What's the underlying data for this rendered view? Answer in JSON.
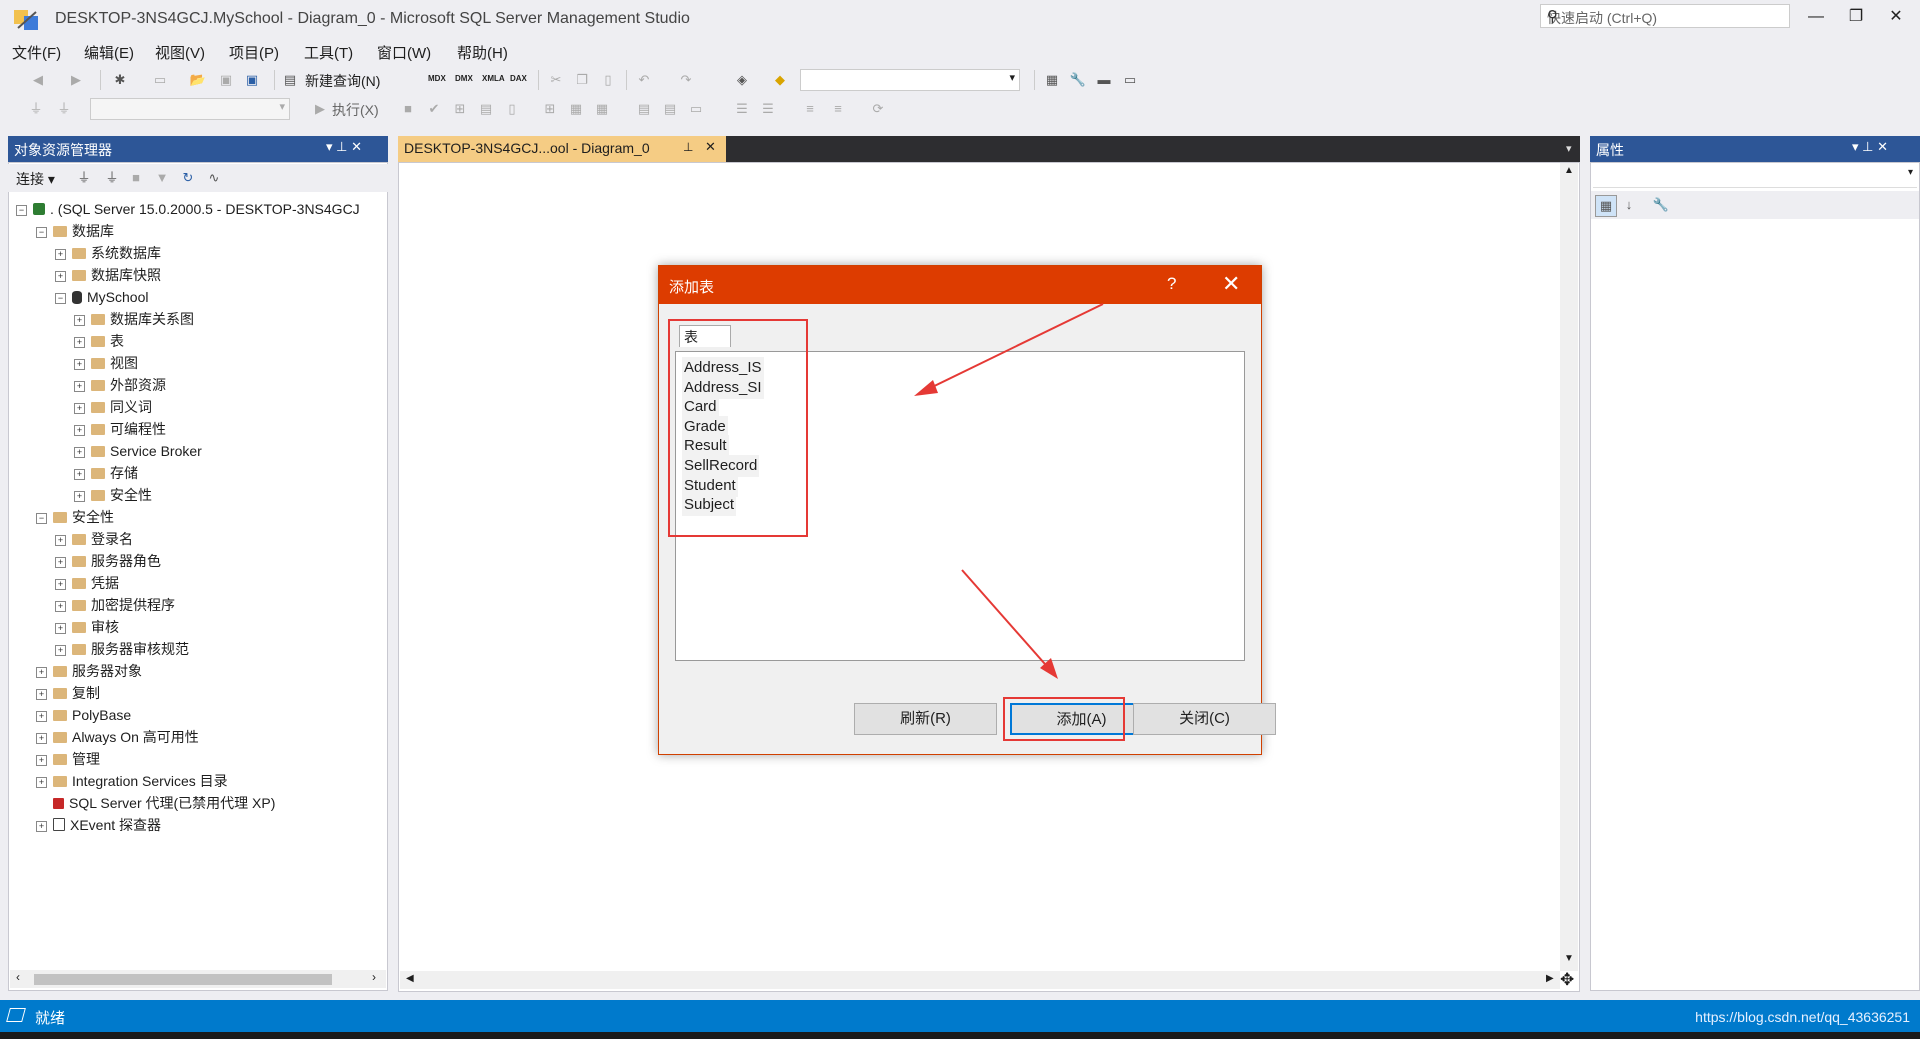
{
  "window": {
    "title": "DESKTOP-3NS4GCJ.MySchool - Diagram_0 - Microsoft SQL Server Management Studio",
    "quick_launch_placeholder": "快速启动 (Ctrl+Q)",
    "minimize": "—",
    "restore": "❐",
    "close": "✕"
  },
  "menu": [
    "文件(F)",
    "编辑(E)",
    "视图(V)",
    "项目(P)",
    "工具(T)",
    "窗口(W)",
    "帮助(H)"
  ],
  "toolbar": {
    "new_query": "新建查询(N)",
    "execute": "执行(X)",
    "mdx": "MDX",
    "dmx": "DMX",
    "xmla": "XMLA",
    "dax": "DAX"
  },
  "object_explorer": {
    "title": "对象资源管理器",
    "pin": "▾ ⊥ ✕",
    "connect": "连接 ▾",
    "server": ". (SQL Server 15.0.2000.5 - DESKTOP-3NS4GCJ",
    "items": [
      {
        "label": "数据库",
        "level": 1,
        "exp": "−"
      },
      {
        "label": "系统数据库",
        "level": 2,
        "exp": "+"
      },
      {
        "label": "数据库快照",
        "level": 2,
        "exp": "+"
      },
      {
        "label": "MySchool",
        "level": 2,
        "exp": "−",
        "db": true
      },
      {
        "label": "数据库关系图",
        "level": 3,
        "exp": "+"
      },
      {
        "label": "表",
        "level": 3,
        "exp": "+"
      },
      {
        "label": "视图",
        "level": 3,
        "exp": "+"
      },
      {
        "label": "外部资源",
        "level": 3,
        "exp": "+"
      },
      {
        "label": "同义词",
        "level": 3,
        "exp": "+"
      },
      {
        "label": "可编程性",
        "level": 3,
        "exp": "+"
      },
      {
        "label": "Service Broker",
        "level": 3,
        "exp": "+"
      },
      {
        "label": "存储",
        "level": 3,
        "exp": "+"
      },
      {
        "label": "安全性",
        "level": 3,
        "exp": "+"
      },
      {
        "label": "安全性",
        "level": 1,
        "exp": "−"
      },
      {
        "label": "登录名",
        "level": 2,
        "exp": "+"
      },
      {
        "label": "服务器角色",
        "level": 2,
        "exp": "+"
      },
      {
        "label": "凭据",
        "level": 2,
        "exp": "+"
      },
      {
        "label": "加密提供程序",
        "level": 2,
        "exp": "+"
      },
      {
        "label": "审核",
        "level": 2,
        "exp": "+"
      },
      {
        "label": "服务器审核规范",
        "level": 2,
        "exp": "+"
      },
      {
        "label": "服务器对象",
        "level": 1,
        "exp": "+"
      },
      {
        "label": "复制",
        "level": 1,
        "exp": "+"
      },
      {
        "label": "PolyBase",
        "level": 1,
        "exp": "+"
      },
      {
        "label": "Always On 高可用性",
        "level": 1,
        "exp": "+"
      },
      {
        "label": "管理",
        "level": 1,
        "exp": "+"
      },
      {
        "label": "Integration Services 目录",
        "level": 1,
        "exp": "+"
      },
      {
        "label": "SQL Server 代理(已禁用代理 XP)",
        "level": 1,
        "exp": "",
        "agent": true
      },
      {
        "label": "XEvent 探查器",
        "level": 1,
        "exp": "+",
        "xevent": true
      }
    ]
  },
  "document": {
    "tab_label": "DESKTOP-3NS4GCJ...ool - Diagram_0",
    "tab_pin": "⊥",
    "tab_close": "✕"
  },
  "properties": {
    "title": "属性"
  },
  "dialog": {
    "title": "添加表",
    "help": "?",
    "close": "✕",
    "tab": "表",
    "tables": [
      "Address_IS",
      "Address_SI",
      "Card",
      "Grade",
      "Result",
      "SellRecord",
      "Student",
      "Subject"
    ],
    "refresh": "刷新(R)",
    "add": "添加(A)",
    "close_btn": "关闭(C)"
  },
  "status": {
    "text": "就绪",
    "watermark": "https://blog.csdn.net/qq_43636251"
  },
  "colors": {
    "panel_header": "#2d5697",
    "dialog_title": "#dd3c00",
    "status_bar": "#007acc",
    "annotation": "#e53935"
  }
}
